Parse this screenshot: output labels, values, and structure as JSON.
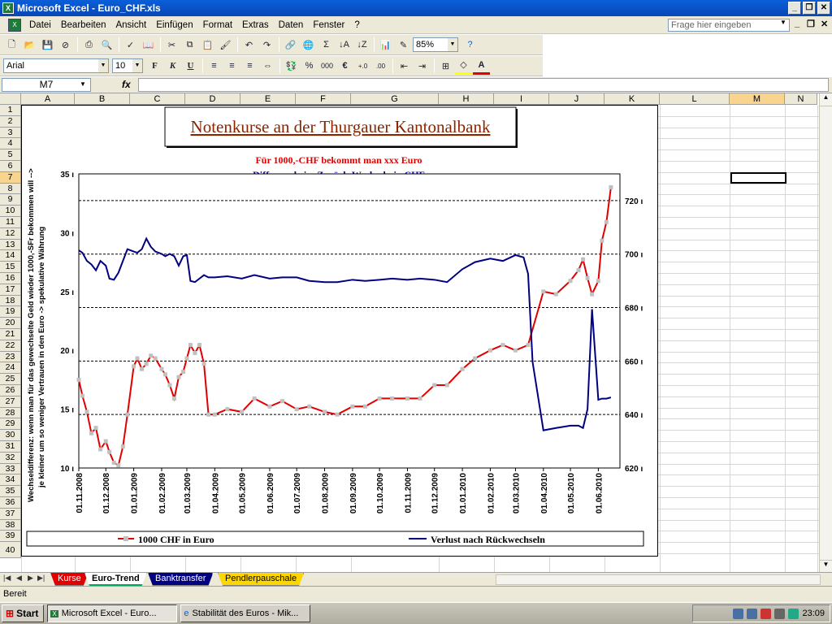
{
  "window": {
    "title": "Microsoft Excel - Euro_CHF.xls",
    "minimize": "_",
    "maximize": "❐",
    "close": "✕"
  },
  "menu": [
    "Datei",
    "Bearbeiten",
    "Ansicht",
    "Einfügen",
    "Format",
    "Extras",
    "Daten",
    "Fenster",
    "?"
  ],
  "help_placeholder": "Frage hier eingeben",
  "toolbar": {
    "zoom": "85%",
    "font": "Arial",
    "size": "10"
  },
  "formula": {
    "cell": "M7",
    "fx": "fx"
  },
  "columns": [
    "A",
    "B",
    "C",
    "D",
    "E",
    "F",
    "G",
    "H",
    "I",
    "J",
    "K",
    "L",
    "M",
    "N"
  ],
  "rows": [
    "1",
    "2",
    "3",
    "4",
    "5",
    "6",
    "7",
    "8",
    "9",
    "10",
    "11",
    "12",
    "13",
    "14",
    "15",
    "16",
    "17",
    "18",
    "19",
    "20",
    "21",
    "22",
    "23",
    "24",
    "25",
    "26",
    "27",
    "28",
    "29",
    "30",
    "31",
    "32",
    "33",
    "34",
    "35",
    "36",
    "37",
    "38",
    "39",
    "40"
  ],
  "sheets": [
    "Kurse",
    "Euro-Trend",
    "Banktransfer",
    "Pendlerpauschale"
  ],
  "status": "Bereit",
  "taskbar": {
    "start": "Start",
    "tasks": [
      "Microsoft Excel - Euro...",
      "Stabilität des Euros - Mik..."
    ],
    "clock": "23:09"
  },
  "chart_data": {
    "type": "line",
    "title": "Notenkurse an der Thurgauer Kantonalbank",
    "subtitle_red": "Für 1000,-CHF bekommt man xxx Euro",
    "subtitle_blue": "Differenz beim Zurück-Wechseln in CHF",
    "ylabel_left_1": "Wechseldifferenz: wenn man für das gewechselte Geld wieder 1000,-SFr bekommen will -->",
    "ylabel_left_2": "je kleiner um so weniger Vertrauen in den Euro -> spekulative Währung",
    "ylim_left": [
      10,
      35
    ],
    "yticks_left": [
      "35",
      "30",
      "25",
      "20",
      "15",
      "10"
    ],
    "ylim_right": [
      620,
      730
    ],
    "yticks_right": [
      "720",
      "700",
      "680",
      "660",
      "640",
      "620"
    ],
    "xticks": [
      "01.11.2008",
      "01.12.2008",
      "01.01.2009",
      "01.02.2009",
      "01.03.2009",
      "01.04.2009",
      "01.05.2009",
      "01.06.2009",
      "01.07.2009",
      "01.08.2009",
      "01.09.2009",
      "01.10.2009",
      "01.11.2009",
      "01.12.2009",
      "01.01.2010",
      "01.02.2010",
      "01.03.2010",
      "01.04.2010",
      "01.05.2010",
      "01.06.2010"
    ],
    "gridlines_right": [
      720,
      700,
      680,
      660,
      640
    ],
    "series": [
      {
        "name": "1000 CHF in Euro",
        "color": "#e00000",
        "axis": "right",
        "x": [
          "01.11.2008",
          "05.11.2008",
          "10.11.2008",
          "15.11.2008",
          "20.11.2008",
          "25.11.2008",
          "01.12.2008",
          "05.12.2008",
          "10.12.2008",
          "15.12.2008",
          "20.12.2008",
          "25.12.2008",
          "01.01.2009",
          "05.01.2009",
          "10.01.2009",
          "15.01.2009",
          "20.01.2009",
          "25.01.2009",
          "01.02.2009",
          "05.02.2009",
          "10.02.2009",
          "15.02.2009",
          "20.02.2009",
          "25.02.2009",
          "01.03.2009",
          "05.03.2009",
          "10.03.2009",
          "15.03.2009",
          "20.03.2009",
          "25.03.2009",
          "01.04.2009",
          "15.04.2009",
          "01.05.2009",
          "15.05.2009",
          "01.06.2009",
          "15.06.2009",
          "01.07.2009",
          "15.07.2009",
          "01.08.2009",
          "15.08.2009",
          "01.09.2009",
          "15.09.2009",
          "01.10.2009",
          "15.10.2009",
          "01.11.2009",
          "15.11.2009",
          "01.12.2009",
          "15.12.2009",
          "01.01.2010",
          "15.01.2010",
          "01.02.2010",
          "15.02.2010",
          "01.03.2010",
          "15.03.2010",
          "01.04.2010",
          "15.04.2010",
          "01.05.2010",
          "10.05.2010",
          "15.05.2010",
          "20.05.2010",
          "25.05.2010",
          "01.06.2010",
          "05.06.2010",
          "10.06.2010",
          "15.06.2010"
        ],
        "y": [
          653,
          647,
          641,
          633,
          635,
          627,
          630,
          626,
          622,
          621,
          628,
          640,
          658,
          661,
          657,
          659,
          662,
          661,
          657,
          655,
          651,
          646,
          654,
          656,
          661,
          666,
          663,
          666,
          659,
          640,
          640,
          642,
          641,
          646,
          643,
          645,
          642,
          643,
          641,
          640,
          643,
          643,
          646,
          646,
          646,
          646,
          651,
          651,
          657,
          661,
          664,
          666,
          664,
          666,
          686,
          685,
          690,
          694,
          698,
          691,
          685,
          690,
          705,
          712,
          725
        ]
      },
      {
        "name": "Verlust nach Rückwechseln",
        "color": "#000080",
        "axis": "left",
        "x": [
          "01.11.2008",
          "05.11.2008",
          "10.11.2008",
          "15.11.2008",
          "20.11.2008",
          "25.11.2008",
          "01.12.2008",
          "05.12.2008",
          "10.12.2008",
          "15.12.2008",
          "20.12.2008",
          "25.12.2008",
          "01.01.2009",
          "05.01.2009",
          "10.01.2009",
          "15.01.2009",
          "20.01.2009",
          "25.01.2009",
          "01.02.2009",
          "05.02.2009",
          "10.02.2009",
          "15.02.2009",
          "20.02.2009",
          "25.02.2009",
          "01.03.2009",
          "05.03.2009",
          "10.03.2009",
          "15.03.2009",
          "20.03.2009",
          "25.03.2009",
          "01.04.2009",
          "15.04.2009",
          "01.05.2009",
          "15.05.2009",
          "01.06.2009",
          "15.06.2009",
          "01.07.2009",
          "15.07.2009",
          "01.08.2009",
          "15.08.2009",
          "01.09.2009",
          "15.09.2009",
          "01.10.2009",
          "15.10.2009",
          "01.11.2009",
          "15.11.2009",
          "01.12.2009",
          "15.12.2009",
          "01.01.2010",
          "15.01.2010",
          "01.02.2010",
          "15.02.2010",
          "01.03.2010",
          "10.03.2010",
          "15.03.2010",
          "20.03.2010",
          "01.04.2010",
          "15.04.2010",
          "01.05.2010",
          "10.05.2010",
          "15.05.2010",
          "20.05.2010",
          "25.05.2010",
          "01.06.2010",
          "05.06.2010",
          "10.06.2010",
          "15.06.2010"
        ],
        "y": [
          28.5,
          28.3,
          27.6,
          27.3,
          26.8,
          27.6,
          27.2,
          26.1,
          26.0,
          26.6,
          27.6,
          28.6,
          28.4,
          28.3,
          28.6,
          29.5,
          28.8,
          28.4,
          28.2,
          28.0,
          28.2,
          28.0,
          27.2,
          28.0,
          28.1,
          25.9,
          25.8,
          26.1,
          26.4,
          26.2,
          26.2,
          26.3,
          26.1,
          26.4,
          26.1,
          26.2,
          26.2,
          25.9,
          25.8,
          25.8,
          26.0,
          25.9,
          26.0,
          26.1,
          26.0,
          26.1,
          26.0,
          25.8,
          26.9,
          27.5,
          27.8,
          27.6,
          28.1,
          27.9,
          26.5,
          19.0,
          13.2,
          13.4,
          13.6,
          13.6,
          13.4,
          15.0,
          23.5,
          15.8,
          15.9,
          15.9,
          16.0
        ]
      }
    ],
    "legend": "bottom"
  }
}
